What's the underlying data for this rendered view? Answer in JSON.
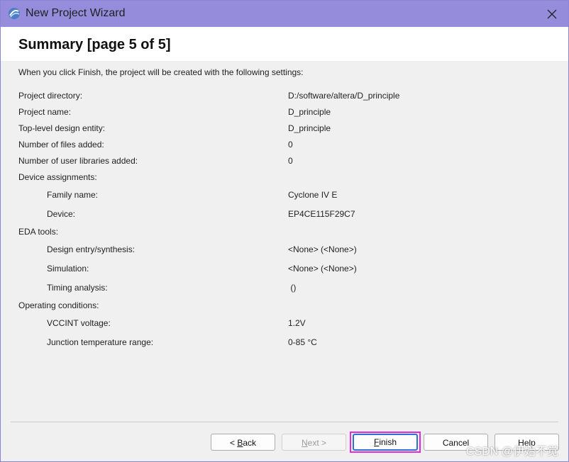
{
  "window": {
    "title": "New Project Wizard",
    "icon": "quartus-wizard-icon",
    "close_icon": "close-icon"
  },
  "page": {
    "heading": "Summary [page 5 of 5]",
    "intro": "When you click Finish, the project will be created with the following settings:"
  },
  "settings": [
    {
      "label": "Project directory:",
      "value": "D:/software/altera/D_principle"
    },
    {
      "label": "Project name:",
      "value": "D_principle"
    },
    {
      "label": "Top-level design entity:",
      "value": "D_principle"
    },
    {
      "label": "Number of files added:",
      "value": "0"
    },
    {
      "label": "Number of user libraries added:",
      "value": "0"
    },
    {
      "label": "Device assignments:",
      "value": ""
    },
    {
      "label": "Family name:",
      "value": "Cyclone IV E"
    },
    {
      "label": "Device:",
      "value": "EP4CE115F29C7"
    },
    {
      "label": "EDA tools:",
      "value": ""
    },
    {
      "label": "Design entry/synthesis:",
      "value": "<None> (<None>)"
    },
    {
      "label": "Simulation:",
      "value": "<None> (<None>)"
    },
    {
      "label": "Timing analysis:",
      "value": " ()"
    },
    {
      "label": "Operating conditions:",
      "value": ""
    },
    {
      "label": "VCCINT voltage:",
      "value": "1.2V"
    },
    {
      "label": "Junction temperature range:",
      "value": "0-85 °C"
    }
  ],
  "buttons": {
    "back": {
      "prefix": "< ",
      "mnemonic": "B",
      "rest": "ack"
    },
    "next": {
      "mnemonic": "N",
      "rest": "ext >"
    },
    "finish": {
      "mnemonic": "F",
      "rest": "inish"
    },
    "cancel": "Cancel",
    "help": "Help"
  },
  "watermark": "CSDN @伊始不觉",
  "colors": {
    "titlebar": "#958ddc",
    "highlight": "#e02ce0",
    "default_button_border": "#2f6fd6"
  }
}
